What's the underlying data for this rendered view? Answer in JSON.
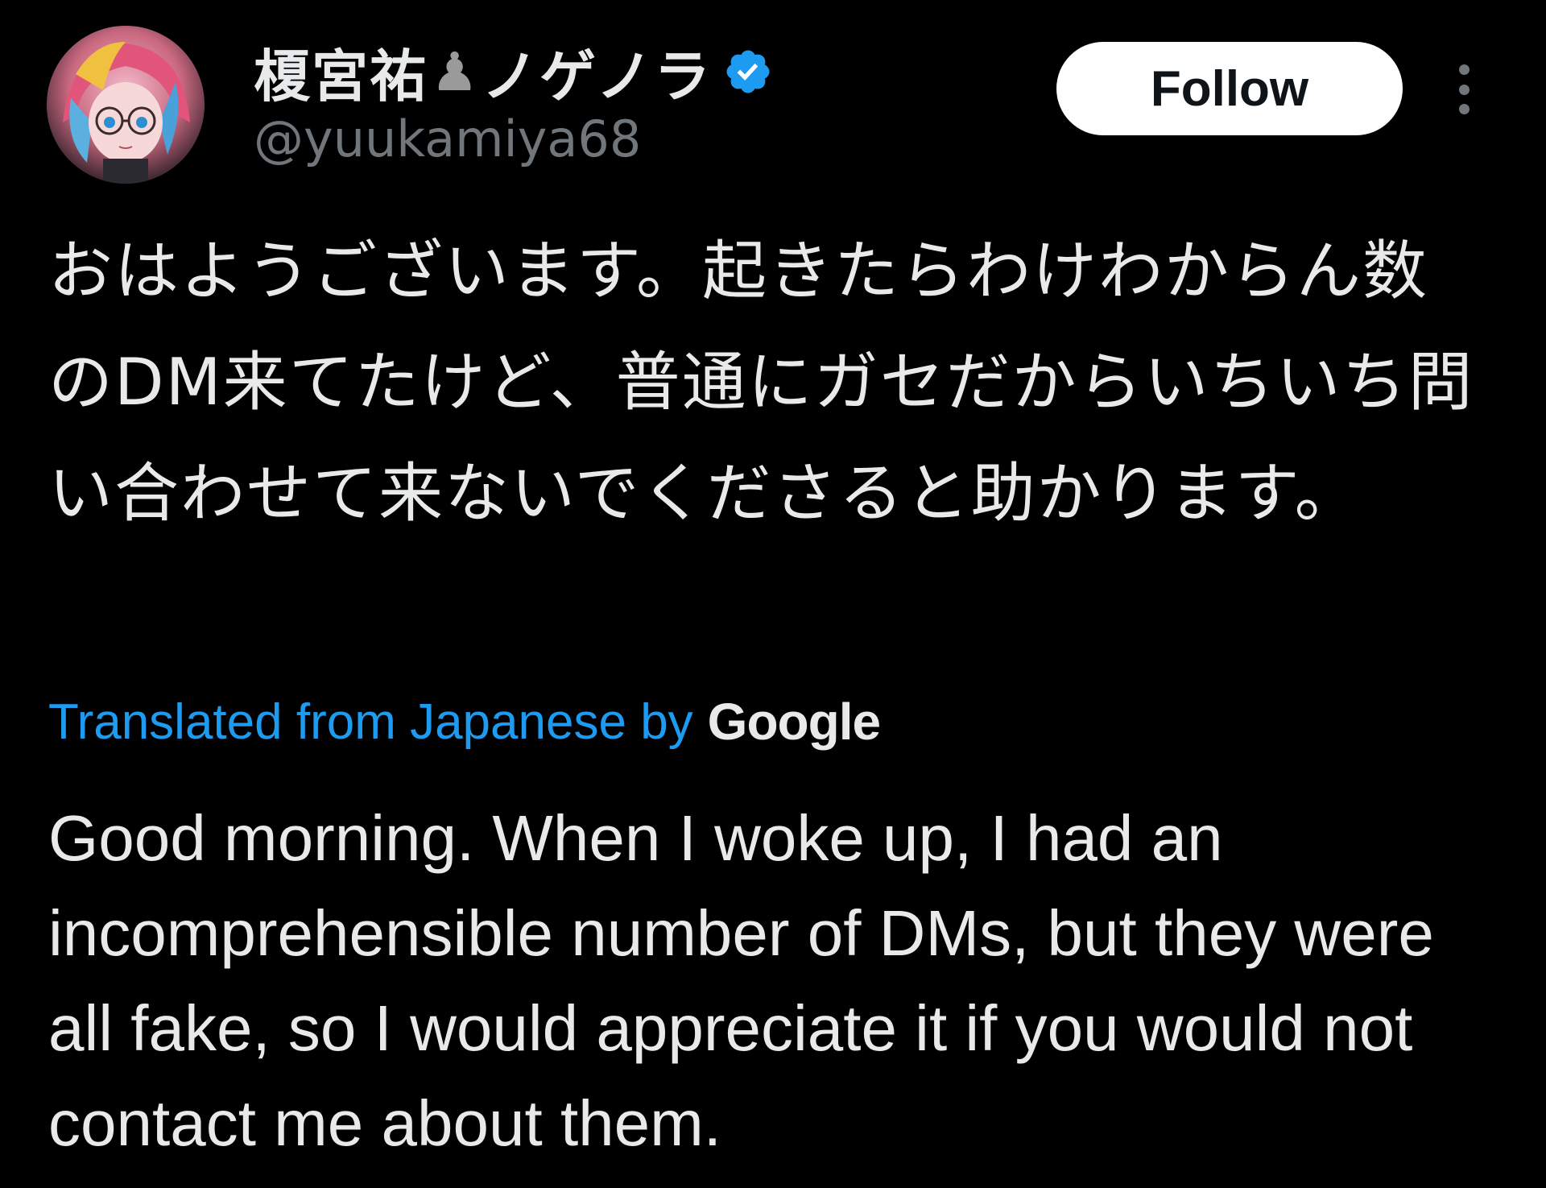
{
  "author": {
    "display_name": "榎宮祐",
    "display_name_suffix": "ノゲノラ",
    "handle": "@yuukamiya68",
    "verified_icon": "verified-badge-icon",
    "pawn_icon": "chess-pawn-icon",
    "avatar_icon": "avatar"
  },
  "actions": {
    "follow_label": "Follow",
    "more_icon": "more-options-icon"
  },
  "tweet": {
    "original_text": "おはようございます。起きたらわけわからん数のDM来てたけど、普通にガセだからいちいち問い合わせて来ないでくださると助かります。",
    "translation_label": "Translated from Japanese by",
    "translation_provider": "Google",
    "translated_text": "Good morning. When I woke up, I had an incomprehensible number of DMs, but they were all fake, so I would appreciate it if you would not contact me about them."
  },
  "colors": {
    "background": "#000000",
    "text": "#e7e9ea",
    "secondary_text": "#71767b",
    "link": "#1d9bf0",
    "verified": "#1d9bf0",
    "follow_bg": "#ffffff"
  }
}
